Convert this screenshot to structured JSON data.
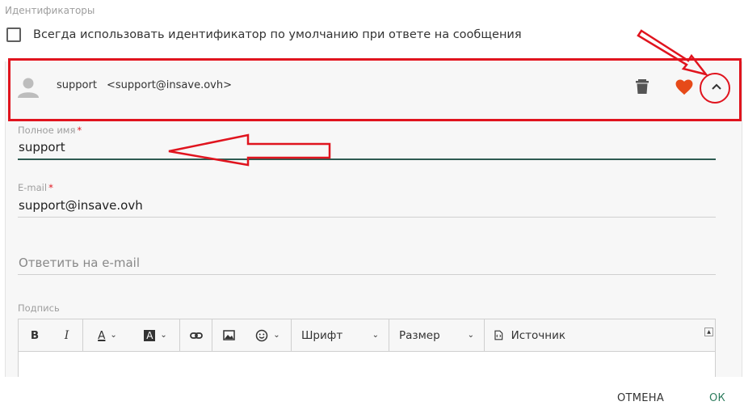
{
  "section_title": "Идентификаторы",
  "default_option": {
    "label": "Всегда использовать идентификатор по умолчанию при ответе на сообщения",
    "checked": false
  },
  "identity": {
    "name": "support",
    "email": "<support@insave.ovh>",
    "icons": {
      "avatar": "person-icon",
      "delete": "trash-icon",
      "favorite": "heart-icon",
      "collapse": "chevron-up-icon"
    },
    "favorite_color": "#e64a19"
  },
  "form": {
    "full_name": {
      "label": "Полное имя",
      "required_mark": "*",
      "value": "support"
    },
    "email": {
      "label": "E-mail",
      "required_mark": "*",
      "value": "support@insave.ovh"
    },
    "reply_to": {
      "placeholder": "Ответить на e-mail",
      "value": ""
    },
    "signature": {
      "label": "Подпись",
      "toolbar": {
        "bold": "B",
        "italic": "I",
        "text_color": "A",
        "bg_color": "A",
        "font": "Шрифт",
        "size": "Размер",
        "source": "Источник"
      }
    }
  },
  "actions": {
    "cancel": "ОТМЕНА",
    "ok": "ОК"
  },
  "colors": {
    "annotation": "#e0141e",
    "accent": "#2e5b52",
    "ok_button": "#2e7d5e"
  }
}
